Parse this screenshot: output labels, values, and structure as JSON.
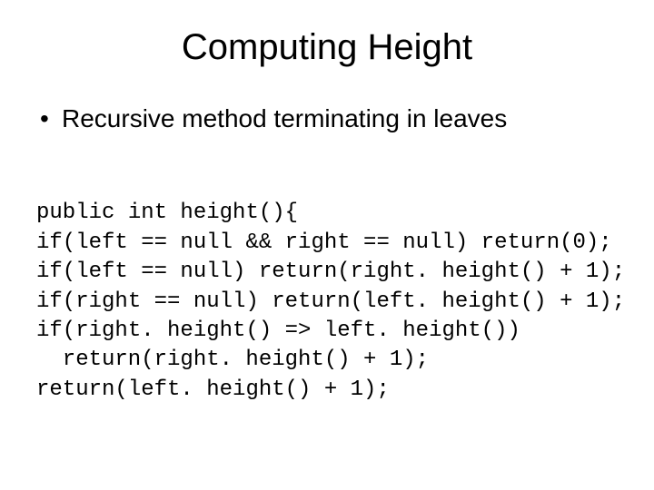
{
  "title": "Computing Height",
  "bullet": "Recursive method terminating in leaves",
  "code": {
    "l1": "public int height(){",
    "l2": "if(left == null && right == null) return(0);",
    "l3": "if(left == null) return(right. height() + 1);",
    "l4": "if(right == null) return(left. height() + 1);",
    "l5": "if(right. height() => left. height())",
    "l6": "return(right. height() + 1);",
    "l7": "return(left. height() + 1);"
  }
}
